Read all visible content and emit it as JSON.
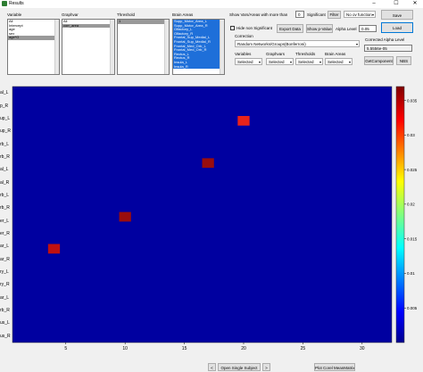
{
  "window": {
    "title": "Results",
    "minimize": "–",
    "maximize": "☐",
    "close": "✕"
  },
  "panels": {
    "variable": {
      "label": "Variable",
      "items": [
        "All",
        "Intercept",
        "age",
        "sex",
        "age*G"
      ],
      "selected": 4
    },
    "graphvar": {
      "label": "Graphvar",
      "items": [
        "All",
        "corr_area"
      ],
      "selected": 1
    },
    "threshold": {
      "label": "Threshold",
      "items": [
        "1"
      ],
      "selected": 0
    },
    "brain_areas": {
      "label": "Brain Areas",
      "items": [
        "Supp_Motor_Area_L",
        "Supp_Motor_Area_R",
        "Olfactory_L",
        "Olfactory_R",
        "Frontal_Sup_Medial_L",
        "Frontal_Sup_Medial_R",
        "Frontal_Med_Orb_L",
        "Frontal_Med_Orb_R",
        "Rectus_L",
        "Rectus_R",
        "Insula_L",
        "Insula_R"
      ]
    }
  },
  "filter": {
    "show_label": "Show Vars/Areas with more than",
    "count": "0",
    "significant_label": "Significant",
    "filter_button": "Filter",
    "function_select": "No ov function",
    "save_button": "Save",
    "hide_label": "Hide non Significant",
    "export_button": "Export Data",
    "pvalues_button": "Show p-Values",
    "alpha_label": "Alpha Level",
    "alpha_value": "0.05",
    "load_button": "Load"
  },
  "correction": {
    "label": "Correction",
    "value": "Random Networks/Groups(Bonferroni)",
    "corrected_alpha_label": "Corrected Alpha Level",
    "corrected_alpha_value": "5.5556e-05",
    "getcomponent_button": "GetComponent",
    "nbs_button": "NBS"
  },
  "selectors": [
    {
      "label": "Variables",
      "value": "Selected"
    },
    {
      "label": "Graphvars",
      "value": "Selected"
    },
    {
      "label": "Thresholds",
      "value": "Selected"
    },
    {
      "label": "Brain Areas",
      "value": "Selected"
    }
  ],
  "heatmap": {
    "background_color": "#0000a0",
    "row_labels": [
      "al_L",
      "p_R",
      "up_L",
      "up_R",
      "rb_L",
      "rb_R",
      "al_L",
      "al_R",
      "rb_L",
      "rb_R",
      "er_L",
      "er_R",
      "ar_L",
      "ar_R",
      "ry_L",
      "ry_R",
      "ar_L",
      "rb_R",
      "us_L",
      "us_R"
    ],
    "x_ticks": [
      "5",
      "10",
      "15",
      "20",
      "25",
      "30"
    ],
    "x_range": [
      0.5,
      32.5
    ],
    "y_range": [
      0.5,
      20.5
    ],
    "cells": [
      {
        "x": 20,
        "y": 3.3,
        "value": 0.034
      },
      {
        "x": 17,
        "y": 6.6,
        "value": 0.03
      },
      {
        "x": 10,
        "y": 10.8,
        "value": 0.03
      },
      {
        "x": 4,
        "y": 13.3,
        "value": 0.033
      }
    ],
    "colorbar": {
      "ticks": [
        "0.035",
        "0.03",
        "0.025",
        "0.02",
        "0.015",
        "0.01",
        "0.005"
      ],
      "range": [
        0,
        0.037
      ]
    }
  },
  "bottom": {
    "prev": "<",
    "open_single": "Open Single Subject",
    "next": ">",
    "plot_button": "Plot Corel MeanMatrix"
  }
}
